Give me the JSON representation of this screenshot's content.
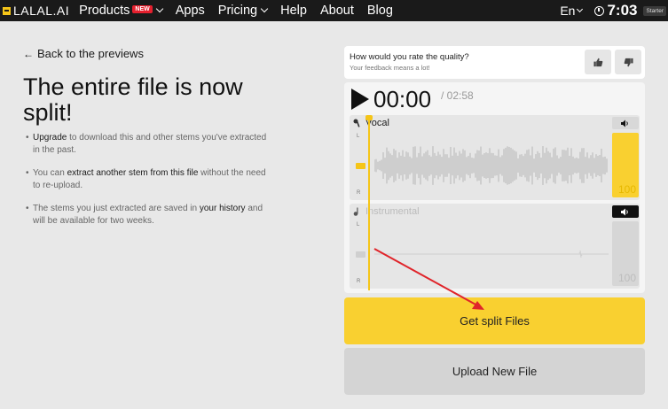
{
  "header": {
    "logo_text": "LALAL.AI",
    "nav": [
      {
        "label": "Products",
        "badge": "NEW"
      },
      {
        "label": "Apps"
      },
      {
        "label": "Pricing"
      },
      {
        "label": "Help"
      },
      {
        "label": "About"
      },
      {
        "label": "Blog"
      }
    ],
    "language": "En",
    "time_left": "7:03",
    "plan": "Starter"
  },
  "left": {
    "back_link": "Back to the previews",
    "title": "The entire file is now split!",
    "bullet1": {
      "link": "Upgrade",
      "text": " to download this and other stems you've extracted in the past."
    },
    "bullet2": {
      "pre": "You can ",
      "link": "extract another stem from this file",
      "post": " without the need to re-upload."
    },
    "bullet3": {
      "pre": "The stems you just extracted are saved in ",
      "link": "your history",
      "post": " and will be available for two weeks."
    }
  },
  "rating": {
    "question": "How would you rate the quality?",
    "subtitle": "Your feedback means a lot!"
  },
  "player": {
    "current_time": "00:00",
    "total_time": "/ 02:58",
    "tracks": [
      {
        "name": "Vocal",
        "volume": "100",
        "channel_left": "L",
        "channel_right": "R",
        "muted": false
      },
      {
        "name": "Instrumental",
        "volume": "100",
        "channel_left": "L",
        "channel_right": "R",
        "muted": true
      }
    ]
  },
  "actions": {
    "get_files": "Get split Files",
    "upload_new": "Upload New File"
  },
  "colors": {
    "accent": "#f9d030",
    "nav_bg": "#1a1a1a",
    "annotation_arrow": "#e0242a"
  }
}
